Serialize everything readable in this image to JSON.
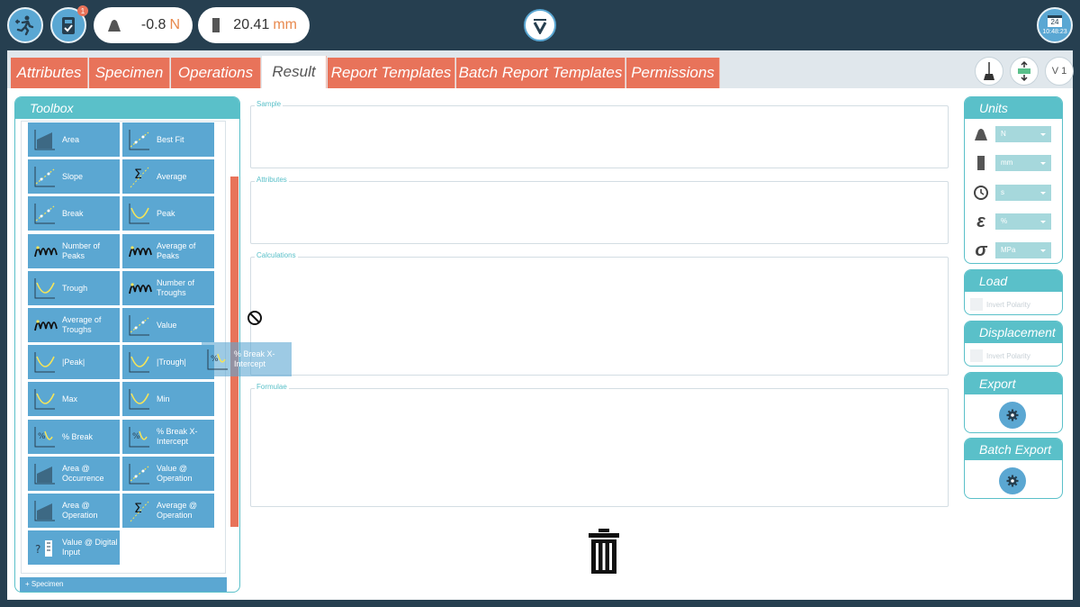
{
  "topbar": {
    "notification_count": "1",
    "load_readout": {
      "value": "-0.8",
      "unit": "N"
    },
    "displacement_readout": {
      "value": "20.41",
      "unit": "mm"
    },
    "clock": {
      "day": "24",
      "time": "10:48:23"
    }
  },
  "tabs": [
    {
      "label": "Attributes",
      "active": false
    },
    {
      "label": "Specimen",
      "active": false
    },
    {
      "label": "Operations",
      "active": false
    },
    {
      "label": "Result",
      "active": true
    },
    {
      "label": "Report Templates",
      "active": false
    },
    {
      "label": "Batch Report Templates",
      "active": false
    },
    {
      "label": "Permissions",
      "active": false
    }
  ],
  "right_tools": {
    "version_label": "V 1"
  },
  "toolbox": {
    "title": "Toolbox",
    "tools": [
      {
        "label": "Area",
        "icon": "area-chart-icon"
      },
      {
        "label": "Best Fit",
        "icon": "best-fit-icon"
      },
      {
        "label": "Slope",
        "icon": "slope-icon"
      },
      {
        "label": "Average",
        "icon": "average-icon"
      },
      {
        "label": "Break",
        "icon": "break-icon"
      },
      {
        "label": "Peak",
        "icon": "peak-icon"
      },
      {
        "label": "Number of Peaks",
        "icon": "number-of-peaks-icon"
      },
      {
        "label": "Average of Peaks",
        "icon": "average-of-peaks-icon"
      },
      {
        "label": "Trough",
        "icon": "trough-icon"
      },
      {
        "label": "Number of Troughs",
        "icon": "number-of-troughs-icon"
      },
      {
        "label": "Average of Troughs",
        "icon": "average-of-troughs-icon"
      },
      {
        "label": "Value",
        "icon": "value-icon"
      },
      {
        "label": "|Peak|",
        "icon": "abs-peak-icon"
      },
      {
        "label": "|Trough|",
        "icon": "abs-trough-icon"
      },
      {
        "label": "Max",
        "icon": "max-icon"
      },
      {
        "label": "Min",
        "icon": "min-icon"
      },
      {
        "label": "% Break",
        "icon": "percent-break-icon"
      },
      {
        "label": "% Break X-Intercept",
        "icon": "percent-break-x-intercept-icon"
      },
      {
        "label": "Area @ Occurrence",
        "icon": "area-at-occurrence-icon"
      },
      {
        "label": "Value @ Operation",
        "icon": "value-at-operation-icon"
      },
      {
        "label": "Area @ Operation",
        "icon": "area-at-operation-icon"
      },
      {
        "label": "Average @ Operation",
        "icon": "average-at-operation-icon"
      },
      {
        "label": "Value @ Digital Input",
        "icon": "value-at-digital-input-icon"
      }
    ],
    "specimen_section": "Specimen"
  },
  "drag_ghost": {
    "label": "% Break X-Intercept"
  },
  "sections": {
    "sample": "Sample",
    "attributes": "Attributes",
    "calculations": "Calculations",
    "formulae": "Formulae"
  },
  "units_panel": {
    "title": "Units",
    "rows": [
      {
        "icon": "weight-icon",
        "value": "N"
      },
      {
        "icon": "ruler-icon",
        "value": "mm"
      },
      {
        "icon": "clock-icon",
        "value": "s"
      },
      {
        "icon": "strain-epsilon-icon",
        "value": "%"
      },
      {
        "icon": "stress-sigma-icon",
        "value": "MPa"
      }
    ]
  },
  "load_panel": {
    "title": "Load",
    "checkbox_label": "Invert Polarity"
  },
  "displacement_panel": {
    "title": "Displacement",
    "checkbox_label": "Invert Polarity"
  },
  "export_panel": {
    "title": "Export"
  },
  "batch_export_panel": {
    "title": "Batch Export"
  },
  "colors": {
    "accent_teal": "#5ac0c9",
    "tab_orange": "#e8735a",
    "tool_blue": "#5ba7d2",
    "header_navy": "#263f50"
  }
}
